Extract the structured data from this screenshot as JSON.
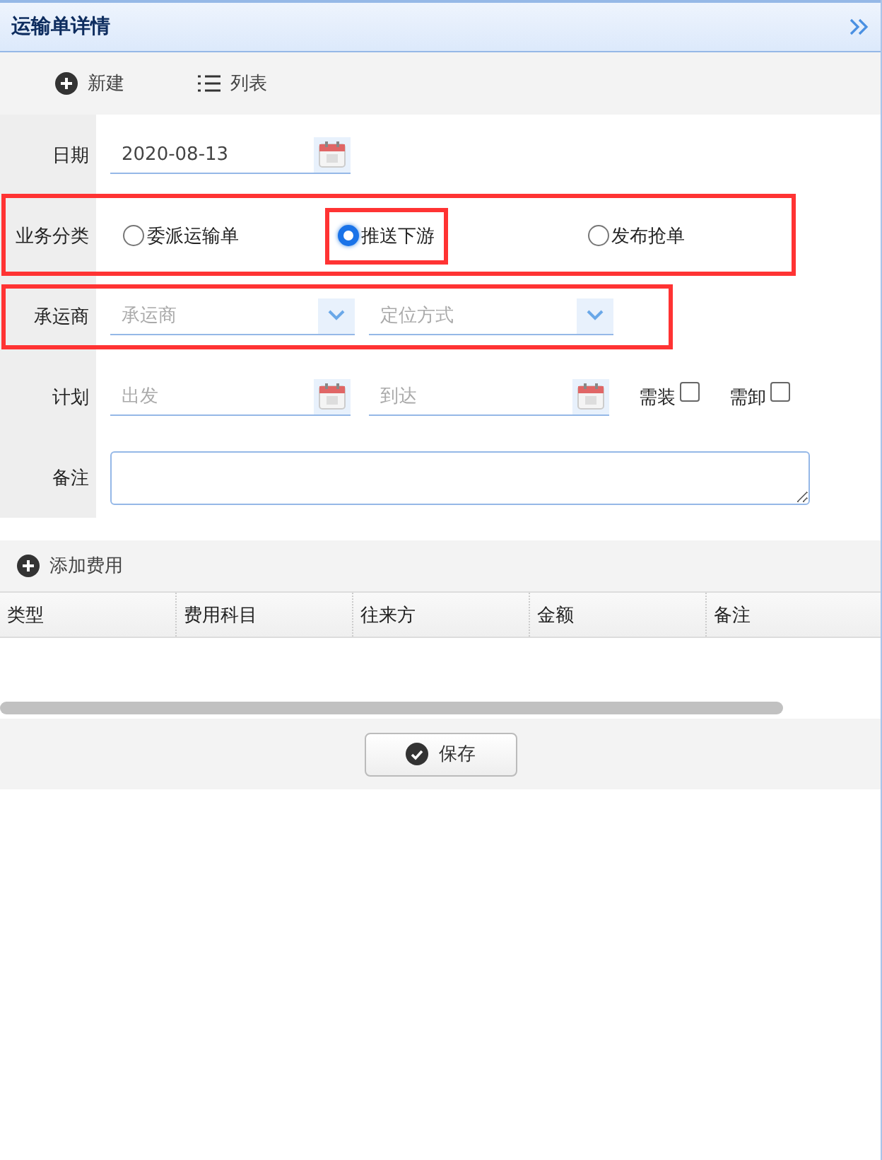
{
  "window": {
    "title": "运输单详情"
  },
  "toolbar": [
    {
      "kind": "add",
      "label": "新建"
    },
    {
      "kind": "list",
      "label": "列表"
    }
  ],
  "form": {
    "date": {
      "label": "日期",
      "value": "2020-08-13"
    },
    "category": {
      "label": "业务分类",
      "highlighted": true,
      "options": [
        {
          "label": "委派运输单",
          "selected": false,
          "highlighted": false
        },
        {
          "label": "推送下游",
          "selected": true,
          "highlighted": true
        },
        {
          "label": "发布抢单",
          "selected": false,
          "highlighted": false
        }
      ]
    },
    "carrier": {
      "label": "承运商",
      "highlighted": true,
      "selects": [
        {
          "placeholder": "承运商"
        },
        {
          "placeholder": "定位方式"
        }
      ]
    },
    "plan": {
      "label": "计划",
      "departure": {
        "placeholder": "出发"
      },
      "arrival": {
        "placeholder": "到达"
      },
      "checks": [
        {
          "label": "需装",
          "checked": false
        },
        {
          "label": "需卸",
          "checked": false
        }
      ]
    },
    "remarks": {
      "label": "备注"
    }
  },
  "expenses": {
    "add_button": "添加费用",
    "columns": [
      "类型",
      "费用科目",
      "往来方",
      "金额",
      "备注"
    ]
  },
  "save_button": "保存"
}
